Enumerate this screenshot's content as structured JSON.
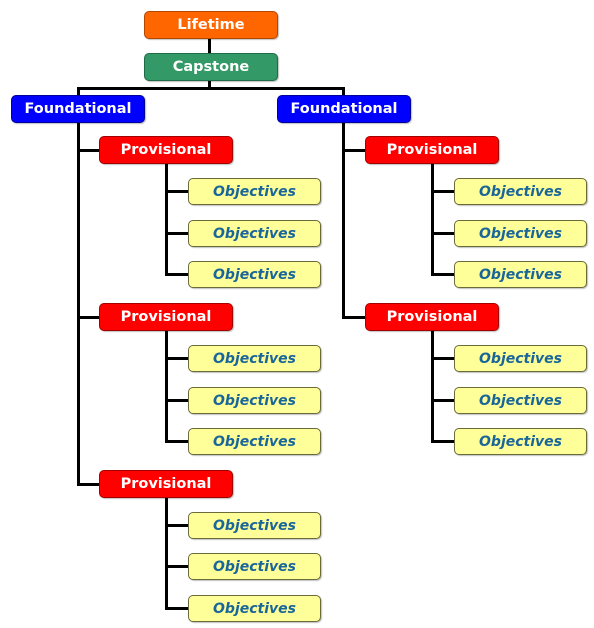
{
  "diagram": {
    "type": "hierarchy-tree",
    "colors": {
      "lifetime": "#ff6600",
      "capstone": "#339966",
      "foundational": "#0000ff",
      "provisional": "#ff0000",
      "objective_fill": "#ffff99",
      "objective_text": "#1a6699",
      "connector": "#000000"
    },
    "root": {
      "label": "Lifetime",
      "child": {
        "label": "Capstone",
        "foundationals": [
          {
            "label": "Foundational",
            "provisionals": [
              {
                "label": "Provisional",
                "objectives": [
                  "Objectives",
                  "Objectives",
                  "Objectives"
                ]
              },
              {
                "label": "Provisional",
                "objectives": [
                  "Objectives",
                  "Objectives",
                  "Objectives"
                ]
              },
              {
                "label": "Provisional",
                "objectives": [
                  "Objectives",
                  "Objectives",
                  "Objectives"
                ]
              }
            ]
          },
          {
            "label": "Foundational",
            "provisionals": [
              {
                "label": "Provisional",
                "objectives": [
                  "Objectives",
                  "Objectives",
                  "Objectives"
                ]
              },
              {
                "label": "Provisional",
                "objectives": [
                  "Objectives",
                  "Objectives",
                  "Objectives"
                ]
              }
            ]
          }
        ]
      }
    }
  }
}
